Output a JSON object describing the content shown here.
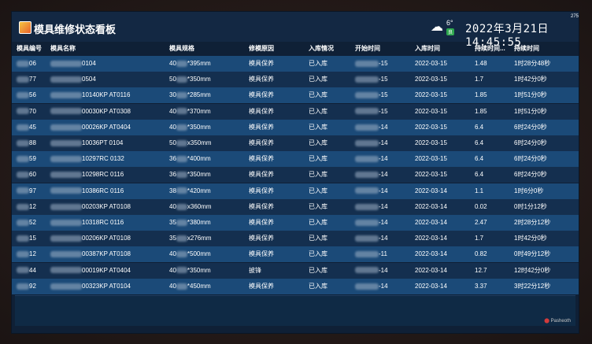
{
  "app": {
    "title": "模具维修状态看板",
    "corner_tag": "275",
    "brand": "Pasheoth"
  },
  "weather": {
    "icon": "partly-cloudy-icon",
    "temperature": "6°",
    "air_quality": "良"
  },
  "clock": "2022年3月21日 14:45:55",
  "table": {
    "columns": [
      "模具编号",
      "模具名称",
      "模具规格",
      "修模原因",
      "入库情况",
      "开始时间",
      "入库时间",
      "持续时间...",
      "持续时间"
    ],
    "rows": [
      {
        "id": "06",
        "name": "0104",
        "spec": "*395mm",
        "spec_prefix": "40",
        "reason": "模具保养",
        "status": "已入库",
        "start": "-15",
        "end": "2022-03-15",
        "hours": "1.48",
        "duration": "1时28分48秒"
      },
      {
        "id": "77",
        "name": "0504",
        "spec": "*350mm",
        "spec_prefix": "50",
        "reason": "模具保养",
        "status": "已入库",
        "start": "-15",
        "end": "2022-03-15",
        "hours": "1.7",
        "duration": "1时42分0秒"
      },
      {
        "id": "56",
        "name": "10140KP AT0116",
        "spec": "*285mm",
        "spec_prefix": "30",
        "reason": "模具保养",
        "status": "已入库",
        "start": "-15",
        "end": "2022-03-15",
        "hours": "1.85",
        "duration": "1时51分0秒"
      },
      {
        "id": "70",
        "name": "00030KP AT0308",
        "spec": "*370mm",
        "spec_prefix": "40",
        "reason": "模具保养",
        "status": "已入库",
        "start": "-15",
        "end": "2022-03-15",
        "hours": "1.85",
        "duration": "1时51分0秒"
      },
      {
        "id": "45",
        "name": "00026KP AT0404",
        "spec": "*350mm",
        "spec_prefix": "40",
        "reason": "模具保养",
        "status": "已入库",
        "start": "-14",
        "end": "2022-03-15",
        "hours": "6.4",
        "duration": "6时24分0秒"
      },
      {
        "id": "88",
        "name": "10036PT 0104",
        "spec": "x350mm",
        "spec_prefix": "50",
        "reason": "模具保养",
        "status": "已入库",
        "start": "-14",
        "end": "2022-03-15",
        "hours": "6.4",
        "duration": "6时24分0秒"
      },
      {
        "id": "59",
        "name": "10297RC 0132",
        "spec": "*400mm",
        "spec_prefix": "36",
        "reason": "模具保养",
        "status": "已入库",
        "start": "-14",
        "end": "2022-03-15",
        "hours": "6.4",
        "duration": "6时24分0秒"
      },
      {
        "id": "60",
        "name": "10298RC 0116",
        "spec": "*350mm",
        "spec_prefix": "36",
        "reason": "模具保养",
        "status": "已入库",
        "start": "-14",
        "end": "2022-03-15",
        "hours": "6.4",
        "duration": "6时24分0秒"
      },
      {
        "id": "97",
        "name": "10386RC 0116",
        "spec": "*420mm",
        "spec_prefix": "38",
        "reason": "模具保养",
        "status": "已入库",
        "start": "-14",
        "end": "2022-03-14",
        "hours": "1.1",
        "duration": "1时6分0秒"
      },
      {
        "id": "12",
        "name": "00203KP AT0108",
        "spec": "x360mm",
        "spec_prefix": "40",
        "reason": "模具保养",
        "status": "已入库",
        "start": "-14",
        "end": "2022-03-14",
        "hours": "0.02",
        "duration": "0时1分12秒"
      },
      {
        "id": "52",
        "name": "10318RC 0116",
        "spec": "*380mm",
        "spec_prefix": "35",
        "reason": "模具保养",
        "status": "已入库",
        "start": "-14",
        "end": "2022-03-14",
        "hours": "2.47",
        "duration": "2时28分12秒"
      },
      {
        "id": "15",
        "name": "00206KP AT0108",
        "spec": "x276mm",
        "spec_prefix": "35",
        "reason": "模具保养",
        "status": "已入库",
        "start": "-14",
        "end": "2022-03-14",
        "hours": "1.7",
        "duration": "1时42分0秒"
      },
      {
        "id": "12",
        "name": "00387KP AT0108",
        "spec": "*500mm",
        "spec_prefix": "40",
        "reason": "模具保养",
        "status": "已入库",
        "start": "-11",
        "end": "2022-03-14",
        "hours": "0.82",
        "duration": "0时49分12秒"
      },
      {
        "id": "44",
        "name": "00019KP AT0404",
        "spec": "*350mm",
        "spec_prefix": "40",
        "reason": "披锋",
        "status": "已入库",
        "start": "-14",
        "end": "2022-03-14",
        "hours": "12.7",
        "duration": "12时42分0秒"
      },
      {
        "id": "92",
        "name": "00323KP AT0104",
        "spec": "*450mm",
        "spec_prefix": "40",
        "reason": "模具保养",
        "status": "已入库",
        "start": "-14",
        "end": "2022-03-14",
        "hours": "3.37",
        "duration": "3时22分12秒"
      }
    ]
  }
}
